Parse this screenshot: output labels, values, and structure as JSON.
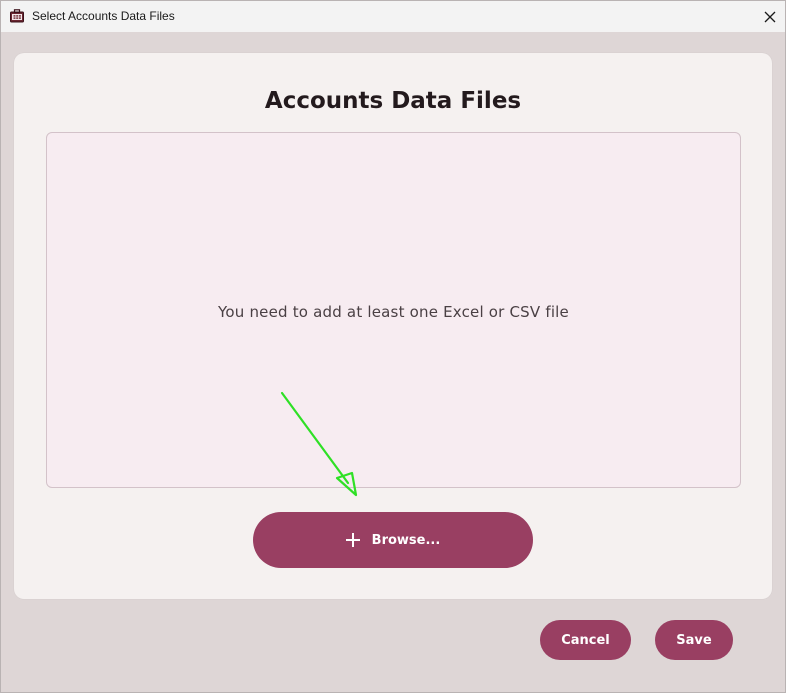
{
  "window": {
    "title": "Select Accounts Data Files"
  },
  "dialog": {
    "heading": "Accounts Data Files",
    "empty_message": "You need to add at least one Excel or CSV file",
    "browse_label": "Browse...",
    "cancel_label": "Cancel",
    "save_label": "Save"
  },
  "icons": {
    "app": "briefcase-icon",
    "close": "close-icon",
    "plus": "plus-icon",
    "annotation": "arrow-annotation"
  },
  "colors": {
    "accent": "#993f62",
    "dropzone_bg": "#f7ecf1",
    "card_bg": "#f5f1f0",
    "window_bg": "#ded6d6",
    "annotation": "#2fe026"
  }
}
